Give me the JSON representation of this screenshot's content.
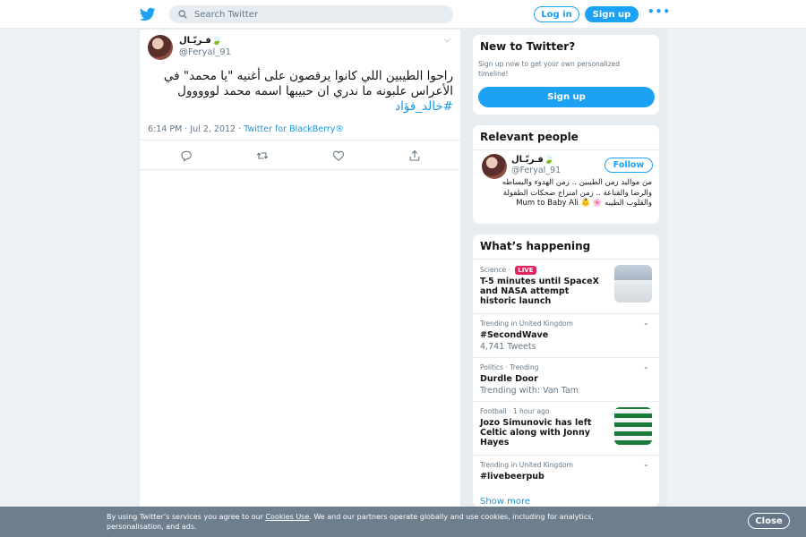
{
  "header": {
    "search_placeholder": "Search Twitter",
    "login_label": "Log in",
    "signup_label": "Sign up",
    "more_label": "•••",
    "logo_icon": "twitter-bird-icon"
  },
  "tweet": {
    "author_name": "فـريّـال🍃",
    "author_handle": "@Feryal_91",
    "text": "راحوا الطيبين اللي كانوا يرقصون على أغنيه \"يا محمد\" في الأعراس علبونه ما ندري ان حبيبها اسمه محمد لووووول ",
    "hashtag": "#خالد_فؤاد",
    "time": "6:14 PM · Jul 2, 2012 · ",
    "source": "Twitter for BlackBerry®",
    "actions": [
      "reply-icon",
      "retweet-icon",
      "like-icon",
      "share-icon"
    ]
  },
  "new_to_twitter": {
    "title": "New to Twitter?",
    "subtitle": "Sign up now to get your own personalized timeline!",
    "signup_label": "Sign up"
  },
  "relevant_people": {
    "title": "Relevant people",
    "name": "فـريّـال🍃",
    "handle": "@Feryal_91",
    "follow_label": "Follow",
    "bio": "من مواليد زمن الطيبين .. زمن الهدوء والبساطه والرضا والقناعة .. زمن امتزاج ضحكات الطفولة والقلوب الطيبه 🌸 👶 Mum to Baby Ali"
  },
  "whats_happening": {
    "title": "What’s happening",
    "show_more": "Show more",
    "trends": [
      {
        "category": "Science · ",
        "live": "LIVE",
        "title": "T-5 minutes until SpaceX and NASA attempt historic launch"
      },
      {
        "category": "Trending in United Kingdom",
        "title": "#SecondWave",
        "count": "4,741 Tweets"
      },
      {
        "category": "Politics · Trending",
        "title": "Durdle Door",
        "count": "Trending with: Van Tam"
      },
      {
        "category": "Football · 1 hour ago",
        "title": "Jozo Simunovic has left Celtic along with Jonny Hayes"
      },
      {
        "category": "Trending in United Kingdom",
        "title": "#livebeerpub"
      }
    ]
  },
  "cookie_bar": {
    "text_before": "By using Twitter’s services you agree to our ",
    "link": "Cookies Use",
    "text_after": ". We and our partners operate globally and use cookies, including for analytics, personalisation, and ads.",
    "close_label": "Close"
  },
  "colors": {
    "accent": "#1da1f2",
    "live": "#e0245e",
    "background": "#e6ecf0"
  }
}
